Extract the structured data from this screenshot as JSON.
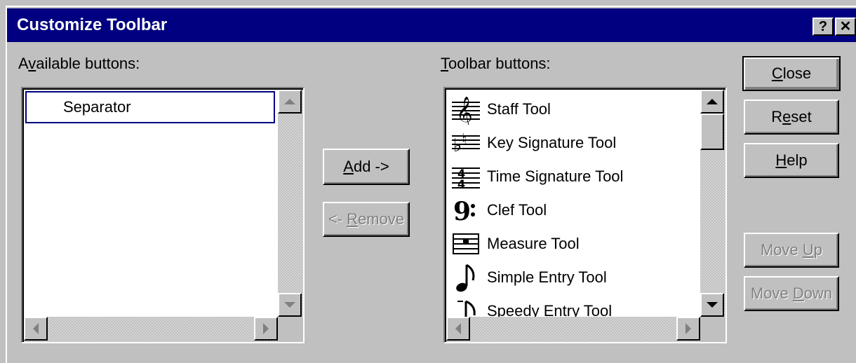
{
  "dialog": {
    "title": "Customize Toolbar",
    "help_glyph": "?",
    "close_glyph": "✕"
  },
  "available": {
    "label_pre": "A",
    "label_accel": "v",
    "label_post": "ailable buttons:",
    "items": [
      {
        "label": "Separator"
      }
    ]
  },
  "toolbar": {
    "label_accel": "T",
    "label_post": "oolbar buttons:",
    "items": [
      {
        "label": "Staff Tool",
        "icon": "staff-tool-icon"
      },
      {
        "label": "Key Signature Tool",
        "icon": "key-signature-icon"
      },
      {
        "label": "Time Signature Tool",
        "icon": "time-signature-icon"
      },
      {
        "label": "Clef Tool",
        "icon": "clef-icon"
      },
      {
        "label": "Measure Tool",
        "icon": "measure-icon"
      },
      {
        "label": "Simple Entry Tool",
        "icon": "simple-entry-icon"
      },
      {
        "label": "Speedy Entry Tool",
        "icon": "speedy-entry-icon"
      }
    ]
  },
  "buttons": {
    "add_accel": "A",
    "add_rest": "dd ->",
    "remove_pre": "<- ",
    "remove_accel": "R",
    "remove_rest": "emove",
    "close_accel": "C",
    "close_rest": "lose",
    "reset_pre": "R",
    "reset_accel": "e",
    "reset_rest": "set",
    "help_accel": "H",
    "help_rest": "elp",
    "moveup_pre": "Move ",
    "moveup_accel": "U",
    "moveup_rest": "p",
    "movedown_pre": "Move ",
    "movedown_accel": "D",
    "movedown_rest": "own"
  },
  "colors": {
    "titlebar": "#000080",
    "face": "#c0c0c0",
    "disabled_text": "#808080"
  }
}
